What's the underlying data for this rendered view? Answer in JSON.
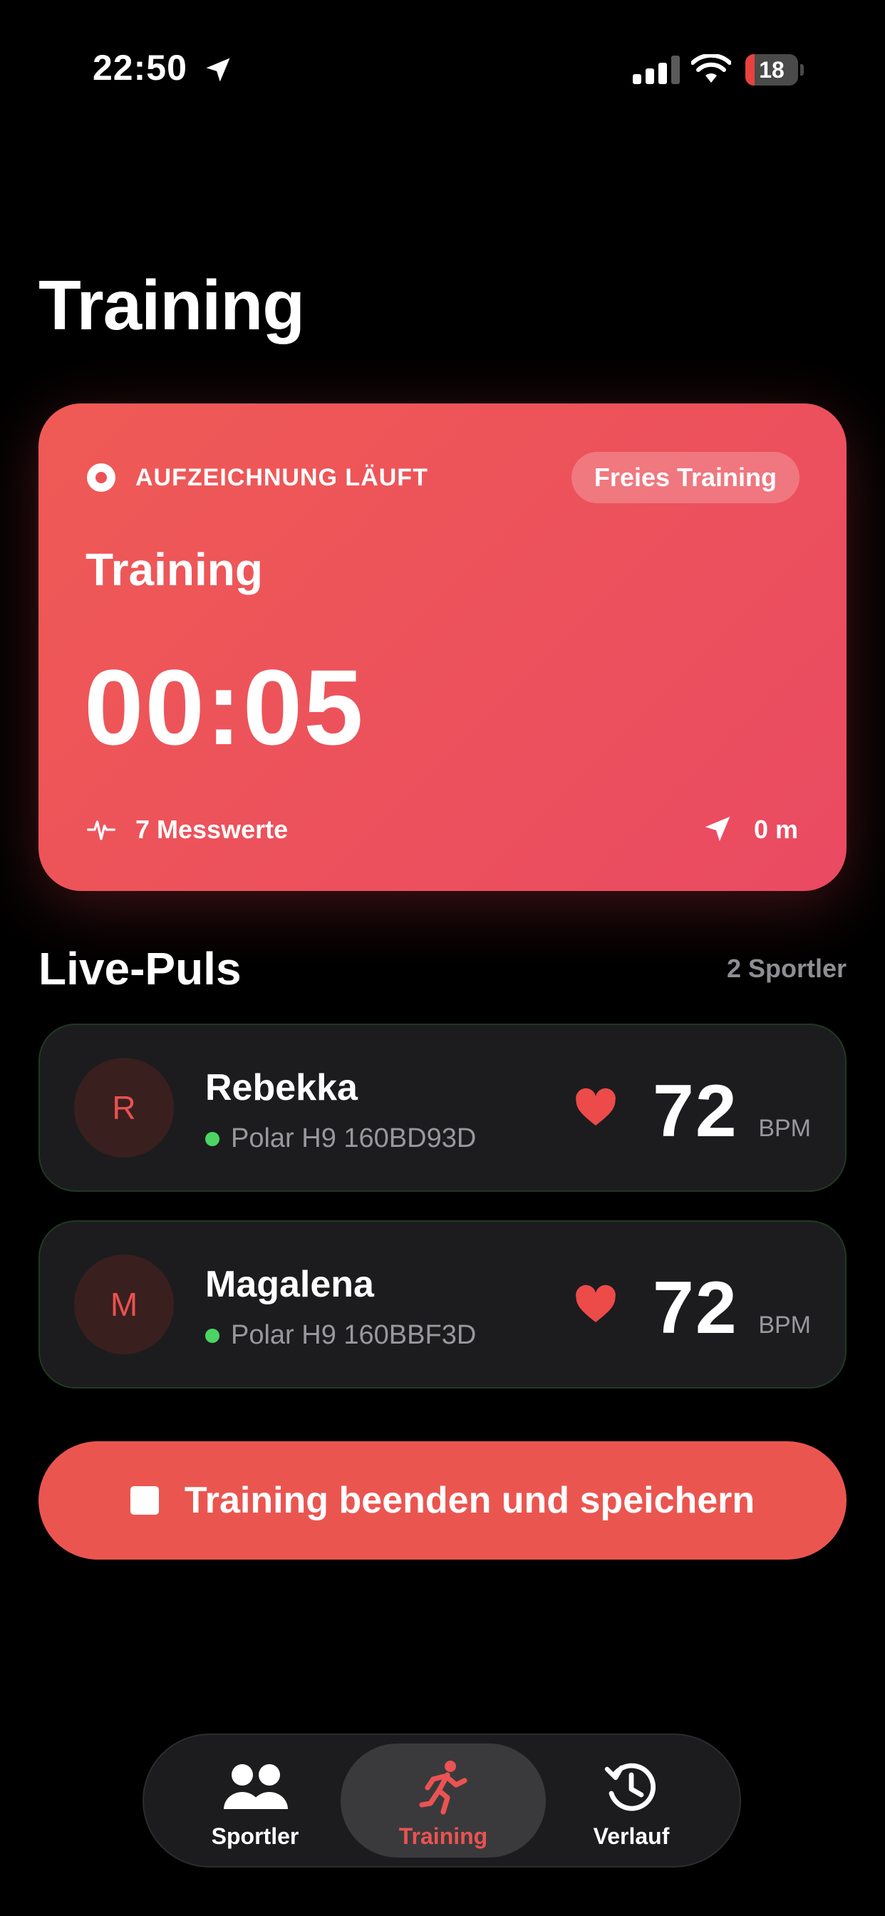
{
  "status_bar": {
    "time": "22:50",
    "battery": "18",
    "battery_level": 0.18
  },
  "page": {
    "title": "Training"
  },
  "recording": {
    "status": "AUFZEICHNUNG LÄUFT",
    "mode": "Freies Training",
    "title": "Training",
    "timer": "00:05",
    "measurements": "7 Messwerte",
    "distance": "0 m"
  },
  "live": {
    "title": "Live-Puls",
    "count": "2 Sportler",
    "athletes": [
      {
        "initial": "R",
        "name": "Rebekka",
        "sensor": "Polar H9 160BD93D",
        "bpm": "72",
        "unit": "BPM"
      },
      {
        "initial": "M",
        "name": "Magalena",
        "sensor": "Polar H9 160BBF3D",
        "bpm": "72",
        "unit": "BPM"
      }
    ]
  },
  "stop_button": {
    "label": "Training beenden und speichern"
  },
  "tabs": [
    {
      "label": "Sportler",
      "icon": "people-icon"
    },
    {
      "label": "Training",
      "icon": "running-icon",
      "active": true
    },
    {
      "label": "Verlauf",
      "icon": "history-icon"
    }
  ],
  "colors": {
    "accent": "#EB5550",
    "connected": "#4CD464",
    "background": "#000000"
  }
}
